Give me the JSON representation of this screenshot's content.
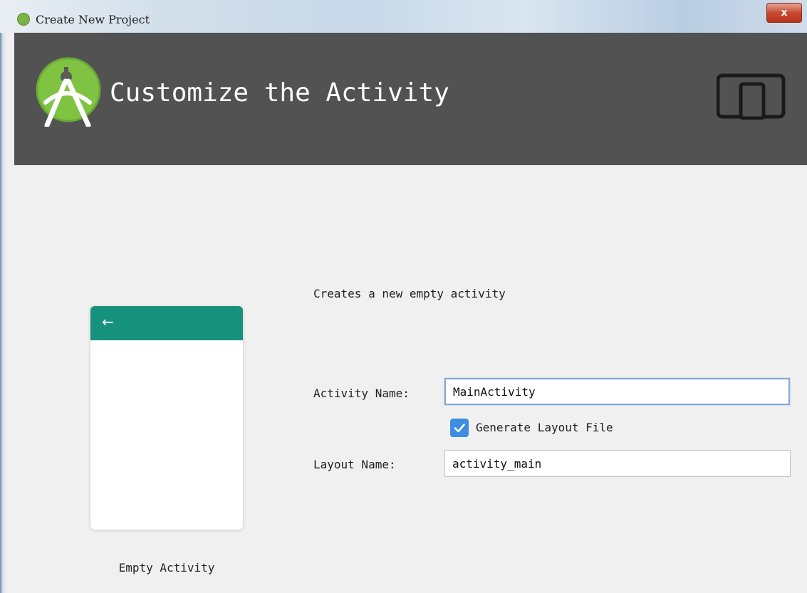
{
  "window": {
    "title": "Create New Project",
    "close_label": "x"
  },
  "header": {
    "title": "Customize the Activity",
    "logo_icon": "android-studio-logo-icon",
    "device_icon": "phone-tablet-icon"
  },
  "preview": {
    "back_glyph": "←",
    "label": "Empty Activity",
    "appbar_color": "#15917c"
  },
  "form": {
    "description": "Creates a new empty activity",
    "activity_name_label": "Activity Name:",
    "activity_name_value": "MainActivity",
    "generate_layout_label": "Generate Layout File",
    "generate_layout_checked": true,
    "layout_name_label": "Layout Name:",
    "layout_name_value": "activity_main"
  }
}
